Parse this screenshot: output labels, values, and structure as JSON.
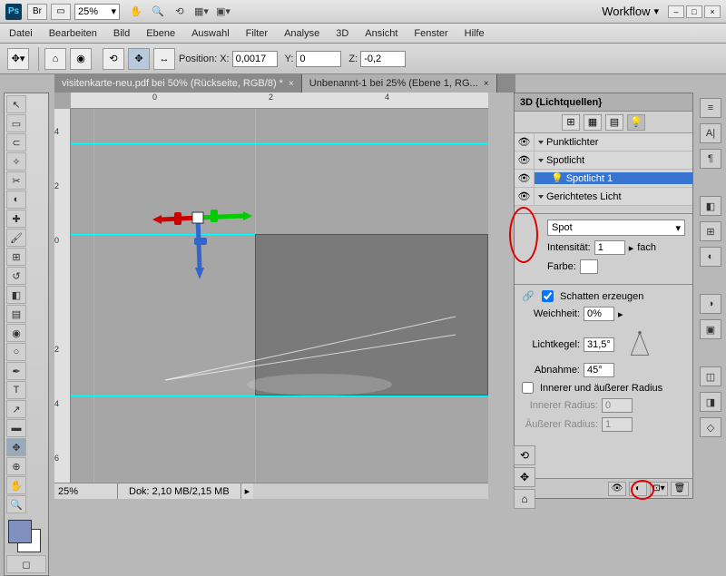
{
  "titlebar": {
    "zoom": "25%",
    "workflow": "Workflow"
  },
  "menu": [
    "Datei",
    "Bearbeiten",
    "Bild",
    "Ebene",
    "Auswahl",
    "Filter",
    "Analyse",
    "3D",
    "Ansicht",
    "Fenster",
    "Hilfe"
  ],
  "options": {
    "position_label": "Position:",
    "x_label": "X:",
    "x_val": "0,0017",
    "y_label": "Y:",
    "y_val": "0",
    "z_label": "Z:",
    "z_val": "-0,2"
  },
  "tabs": [
    {
      "label": "visitenkarte-neu.pdf bei 50% (Rückseite, RGB/8) *",
      "active": false
    },
    {
      "label": "Unbenannt-1 bei 25% (Ebene 1, RG...",
      "active": true
    }
  ],
  "rulerH": [
    "0",
    "2",
    "4"
  ],
  "rulerV": [
    "4",
    "2",
    "0",
    "2",
    "4",
    "6"
  ],
  "status": {
    "zoom": "25%",
    "dok": "Dok: 2,10 MB/2,15 MB"
  },
  "panel": {
    "title": "3D {Lichtquellen}",
    "groups": {
      "punkt": "Punktlichter",
      "spot": "Spotlicht",
      "spot1": "Spotlicht 1",
      "gerichtet": "Gerichtetes Licht"
    },
    "type": "Spot",
    "intensitaet_lbl": "Intensität:",
    "intensitaet_val": "1",
    "fach": "fach",
    "farbe_lbl": "Farbe:",
    "schatten_lbl": "Schatten erzeugen",
    "weichheit_lbl": "Weichheit:",
    "weichheit_val": "0%",
    "lichtkegel_lbl": "Lichtkegel:",
    "lichtkegel_val": "31,5°",
    "abnahme_lbl": "Abnahme:",
    "abnahme_val": "45°",
    "inner_outer_lbl": "Innerer und äußerer Radius",
    "inner_r_lbl": "Innerer Radius:",
    "inner_r_val": "0",
    "outer_r_lbl": "Äußerer Radius:",
    "outer_r_val": "1"
  }
}
